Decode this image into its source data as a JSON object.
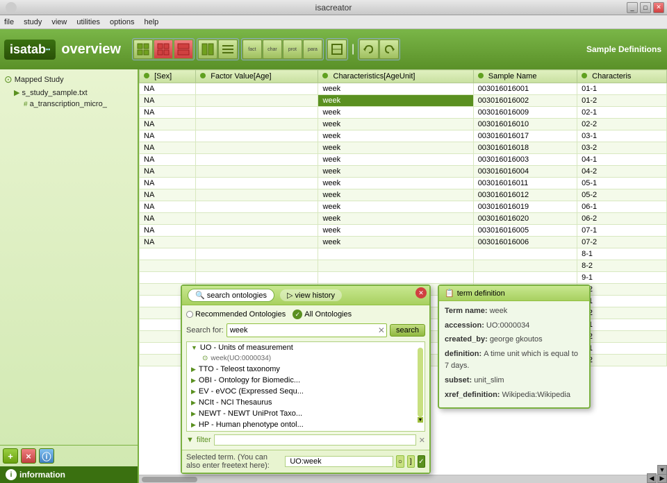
{
  "titleBar": {
    "title": "isacreator",
    "logoShape": "circle",
    "controls": [
      "minimize",
      "maximize",
      "close"
    ]
  },
  "menuBar": {
    "items": [
      "file",
      "study",
      "view",
      "utilities",
      "options",
      "help"
    ]
  },
  "toolbar": {
    "appName": "isatab",
    "appSup": "••",
    "overviewText": "overview",
    "buttons": [
      {
        "id": "grid1",
        "label": "",
        "type": "grid"
      },
      {
        "id": "grid2",
        "label": "",
        "type": "grid-red"
      },
      {
        "id": "grid3",
        "label": "",
        "type": "grid-red2"
      },
      {
        "id": "grid4",
        "label": "",
        "type": "grid2"
      },
      {
        "id": "grid5",
        "label": "",
        "type": "grid3"
      },
      {
        "id": "fact",
        "label": "fact"
      },
      {
        "id": "char",
        "label": "char"
      },
      {
        "id": "prot",
        "label": "prot"
      },
      {
        "id": "para",
        "label": "para"
      },
      {
        "id": "grid6",
        "label": ""
      },
      {
        "id": "sep",
        "label": "|"
      },
      {
        "id": "undo",
        "label": "undo"
      },
      {
        "id": "redo",
        "label": "redo"
      }
    ],
    "sampleDefinitionsLabel": "Sample Definitions"
  },
  "sidebar": {
    "treeItems": [
      {
        "id": "mapped-study",
        "label": "Mapped Study",
        "level": 0,
        "icon": "study"
      },
      {
        "id": "s-study-sample",
        "label": "s_study_sample.txt",
        "level": 1,
        "icon": "file"
      },
      {
        "id": "a-transcription",
        "label": "a_transcription_micro_",
        "level": 2,
        "icon": "grid"
      }
    ],
    "buttons": [
      {
        "id": "add",
        "label": "+"
      },
      {
        "id": "remove",
        "label": "×"
      },
      {
        "id": "info2",
        "label": "ⓘ"
      }
    ],
    "infoBar": "information"
  },
  "table": {
    "columns": [
      {
        "id": "sex",
        "label": "[Sex]",
        "dot": true
      },
      {
        "id": "factor-age",
        "label": "Factor Value[Age]",
        "dot": true
      },
      {
        "id": "char-ageunit",
        "label": "Characteristics[AgeUnit]",
        "dot": true
      },
      {
        "id": "sample-name",
        "label": "Sample Name",
        "dot": true
      },
      {
        "id": "characteristics",
        "label": "Characteris",
        "dot": true
      }
    ],
    "rows": [
      {
        "sex": "NA",
        "factor": "",
        "char": "week",
        "sample": "003016016001",
        "extra": "01-1",
        "selected": false
      },
      {
        "sex": "NA",
        "factor": "",
        "char": "week",
        "sample": "003016016002",
        "extra": "01-2",
        "selected": true
      },
      {
        "sex": "NA",
        "factor": "",
        "char": "week",
        "sample": "003016016009",
        "extra": "02-1",
        "selected": false
      },
      {
        "sex": "NA",
        "factor": "",
        "char": "week",
        "sample": "003016016010",
        "extra": "02-2",
        "selected": false
      },
      {
        "sex": "NA",
        "factor": "",
        "char": "week",
        "sample": "003016016017",
        "extra": "03-1",
        "selected": false
      },
      {
        "sex": "NA",
        "factor": "",
        "char": "week",
        "sample": "003016016018",
        "extra": "03-2",
        "selected": false
      },
      {
        "sex": "NA",
        "factor": "",
        "char": "week",
        "sample": "003016016003",
        "extra": "04-1",
        "selected": false
      },
      {
        "sex": "NA",
        "factor": "",
        "char": "week",
        "sample": "003016016004",
        "extra": "04-2",
        "selected": false
      },
      {
        "sex": "NA",
        "factor": "",
        "char": "week",
        "sample": "003016016011",
        "extra": "05-1",
        "selected": false
      },
      {
        "sex": "NA",
        "factor": "",
        "char": "week",
        "sample": "003016016012",
        "extra": "05-2",
        "selected": false
      },
      {
        "sex": "NA",
        "factor": "",
        "char": "week",
        "sample": "003016016019",
        "extra": "06-1",
        "selected": false
      },
      {
        "sex": "NA",
        "factor": "",
        "char": "week",
        "sample": "003016016020",
        "extra": "06-2",
        "selected": false
      },
      {
        "sex": "NA",
        "factor": "",
        "char": "week",
        "sample": "003016016005",
        "extra": "07-1",
        "selected": false
      },
      {
        "sex": "NA",
        "factor": "",
        "char": "week",
        "sample": "003016016006",
        "extra": "07-2",
        "selected": false
      }
    ],
    "moreRows": [
      {
        "extra": "8-1"
      },
      {
        "extra": "8-2"
      },
      {
        "extra": "9-1"
      },
      {
        "extra": "9-2"
      },
      {
        "extra": "0-1"
      },
      {
        "extra": "0-2"
      },
      {
        "extra": "1-1"
      },
      {
        "extra": "1-2"
      },
      {
        "extra": "2-1"
      },
      {
        "extra": "2-2"
      }
    ]
  },
  "ontologyPanel": {
    "tabs": [
      "search ontologies",
      "view history"
    ],
    "radioOptions": [
      "Recommended Ontologies",
      "All Ontologies"
    ],
    "searchLabel": "Search for:",
    "searchValue": "week",
    "searchPlaceholder": "week",
    "searchButton": "search",
    "results": [
      {
        "id": "uo",
        "label": "UO - Units of measurement",
        "child": "week(UO:0000034)",
        "expanded": true
      },
      {
        "id": "tto",
        "label": "TTO - Teleost taxonomy"
      },
      {
        "id": "obi",
        "label": "OBI - Ontology for Biomedic..."
      },
      {
        "id": "ev",
        "label": "EV - eVOC (Expressed Sequ..."
      },
      {
        "id": "ncit",
        "label": "NCIt - NCI Thesaurus"
      },
      {
        "id": "newt1",
        "label": "NEWT - NEWT UniProt Taxo..."
      },
      {
        "id": "hp",
        "label": "HP - Human phenotype ontol..."
      }
    ],
    "filterLabel": "filter",
    "filterValue": "",
    "selectedTermLabel": "Selected term. (You can also enter freetext here):",
    "selectedTermValue": "UO:week"
  },
  "termDefinition": {
    "headerLabel": "term definition",
    "fields": [
      {
        "label": "Term name:",
        "value": "week"
      },
      {
        "label": "accession:",
        "value": "UO:0000034"
      },
      {
        "label": "created_by:",
        "value": "george gkoutos"
      },
      {
        "label": "definition:",
        "value": "A time unit which is equal to 7 days."
      },
      {
        "label": "subset:",
        "value": "unit_slim"
      },
      {
        "label": "xref_definition:",
        "value": "Wikipedia:Wikipedia"
      }
    ]
  }
}
